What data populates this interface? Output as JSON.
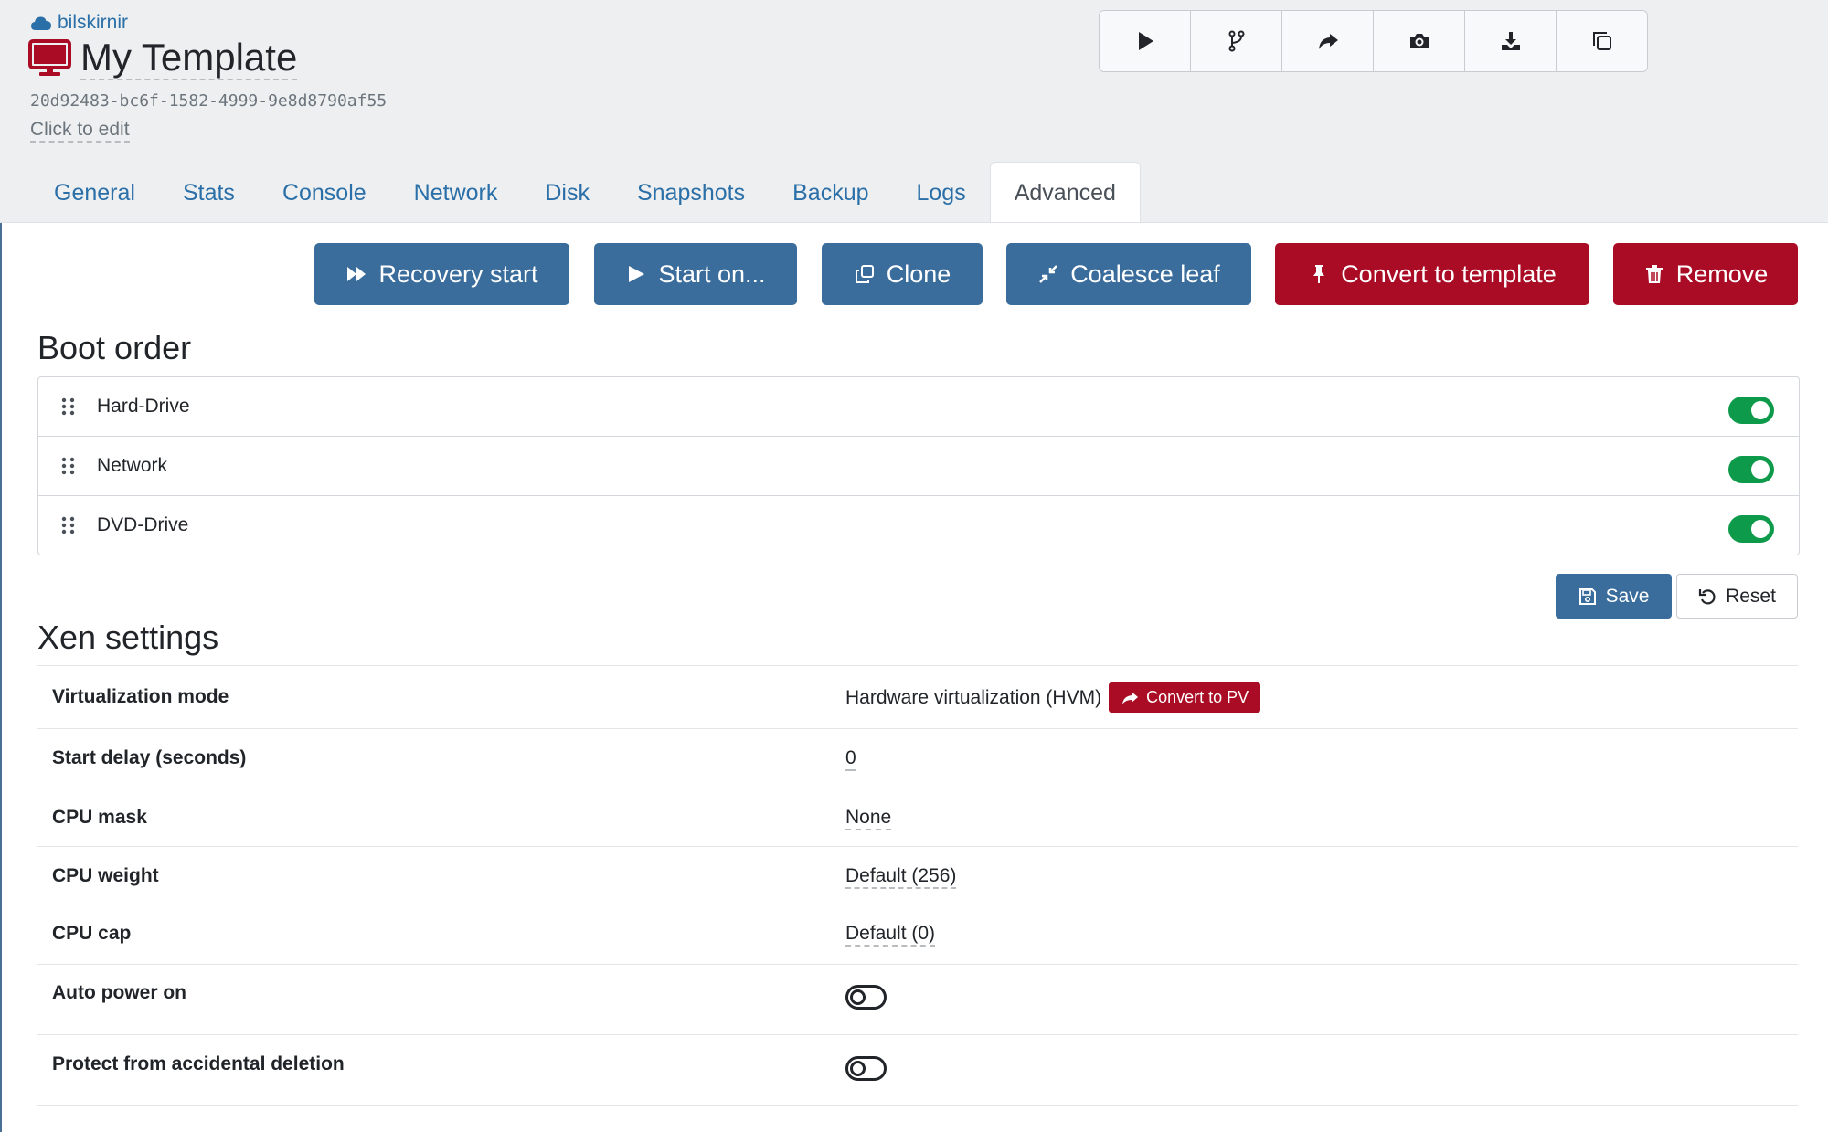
{
  "header": {
    "pool_name": "bilskirnir",
    "title": "My Template",
    "uuid": "20d92483-bc6f-1582-4999-9e8d8790af55",
    "description_placeholder": "Click to edit"
  },
  "action_icons": [
    "play-icon",
    "fork-icon",
    "share-icon",
    "camera-icon",
    "download-icon",
    "copy-icon"
  ],
  "tabs": [
    {
      "label": "General"
    },
    {
      "label": "Stats"
    },
    {
      "label": "Console"
    },
    {
      "label": "Network"
    },
    {
      "label": "Disk"
    },
    {
      "label": "Snapshots"
    },
    {
      "label": "Backup"
    },
    {
      "label": "Logs"
    },
    {
      "label": "Advanced",
      "active": true
    }
  ],
  "toolbar": {
    "recovery_start": "Recovery start",
    "start_on": "Start on...",
    "clone": "Clone",
    "coalesce_leaf": "Coalesce leaf",
    "convert_to_template": "Convert to template",
    "remove": "Remove"
  },
  "boot_order": {
    "title": "Boot order",
    "items": [
      {
        "label": "Hard-Drive",
        "enabled": true
      },
      {
        "label": "Network",
        "enabled": true
      },
      {
        "label": "DVD-Drive",
        "enabled": true
      }
    ],
    "save_label": "Save",
    "reset_label": "Reset"
  },
  "xen_settings": {
    "title": "Xen settings",
    "rows": [
      {
        "label": "Virtualization mode",
        "value": "Hardware virtualization (HVM)",
        "action": "Convert to PV"
      },
      {
        "label": "Start delay (seconds)",
        "value": "0"
      },
      {
        "label": "CPU mask",
        "value": "None"
      },
      {
        "label": "CPU weight",
        "value": "Default (256)"
      },
      {
        "label": "CPU cap",
        "value": "Default (0)"
      },
      {
        "label": "Auto power on",
        "toggle": false
      },
      {
        "label": "Protect from accidental deletion",
        "toggle": false
      }
    ]
  },
  "colors": {
    "primary": "#3a6d9c",
    "danger": "#ab0c25",
    "success": "#0e9a4b",
    "link": "#2a6fa8"
  }
}
